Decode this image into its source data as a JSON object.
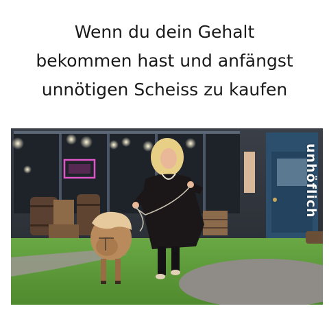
{
  "caption": {
    "line1": "Wenn du dein Gehalt",
    "line2": "bekommen hast und anfängst",
    "line3": "unnötigen Scheiss zu kaufen"
  },
  "photo": {
    "subject": "woman-walking-pony",
    "watermark": "unhöflich"
  },
  "colors": {
    "background": "#ffffff",
    "caption_text": "#1a1a1a",
    "grass": "#5e9a3a",
    "door": "#2c4f6e"
  }
}
